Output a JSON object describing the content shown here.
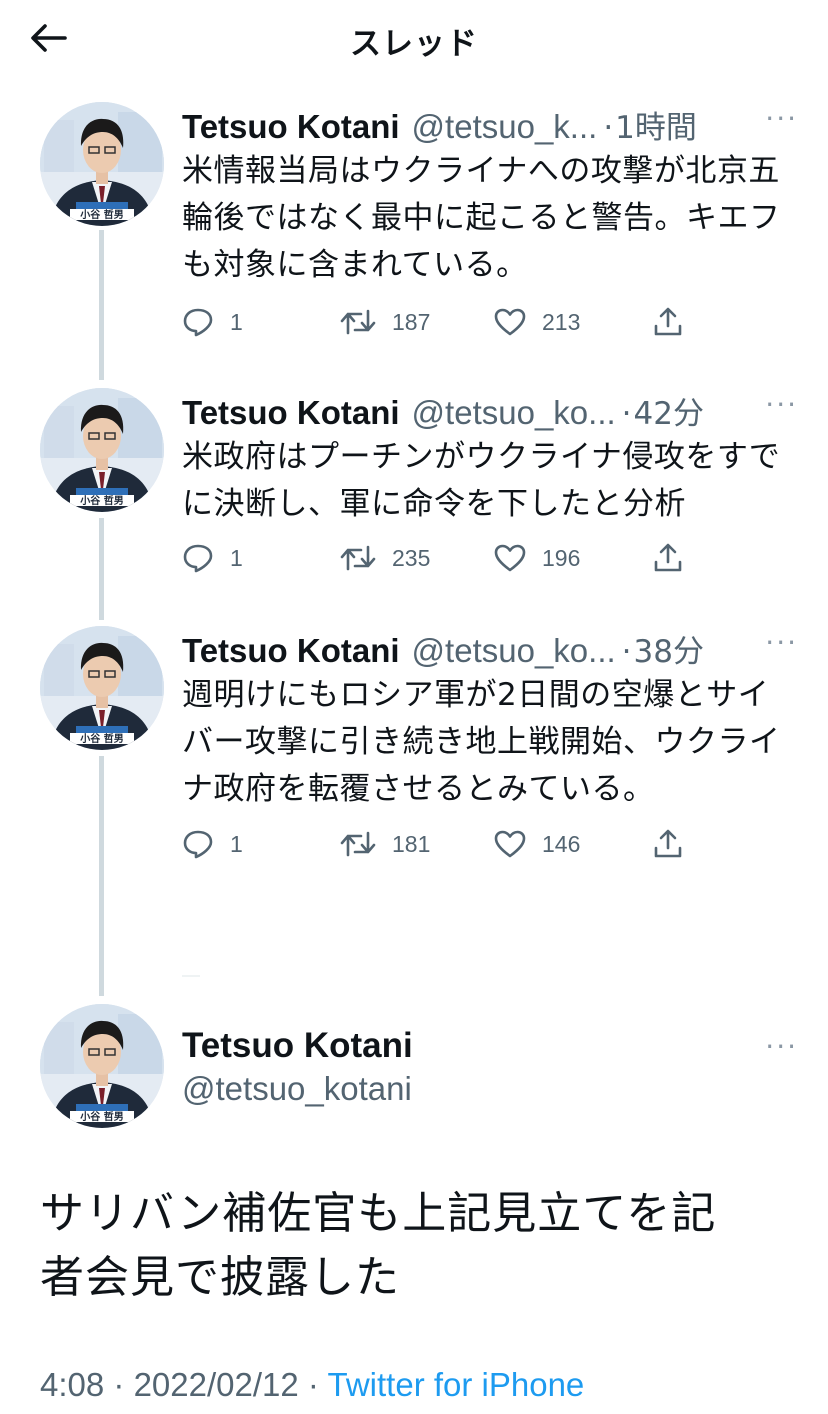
{
  "header": {
    "back_icon": "arrow-left-icon",
    "title": "スレッド"
  },
  "author": {
    "name": "Tetsuo Kotani",
    "handle_full": "@tetsuo_kotani",
    "avatar_caption": "小谷 哲男"
  },
  "tweets": [
    {
      "handle": "@tetsuo_k...",
      "sep": "·",
      "time": "1時間",
      "more": "···",
      "text": "米情報当局はウクライナへの攻撃が北京五輪後ではなく最中に起こると警告。キエフも対象に含まれている。",
      "replies": "1",
      "retweets": "187",
      "likes": "213"
    },
    {
      "handle": "@tetsuo_ko...",
      "sep": "·",
      "time": "42分",
      "more": "···",
      "text": "米政府はプーチンがウクライナ侵攻をすでに決断し、軍に命令を下したと分析",
      "replies": "1",
      "retweets": "235",
      "likes": "196"
    },
    {
      "handle": "@tetsuo_ko...",
      "sep": "·",
      "time": "38分",
      "more": "···",
      "text": "週明けにもロシア軍が2日間の空爆とサイバー攻撃に引き続き地上戦開始、ウクライナ政府を転覆させるとみている。",
      "replies": "1",
      "retweets": "181",
      "likes": "146"
    }
  ],
  "main_tweet": {
    "more": "···",
    "text": "サリバン補佐官も上記見立てを記者会見で披露した",
    "time": "4:08",
    "sep": "·",
    "date": "2022/02/12",
    "source": "Twitter for iPhone"
  },
  "colors": {
    "text": "#0f1419",
    "secondary": "#536471",
    "link": "#1d9bf0",
    "thread_line": "#cfd9de"
  }
}
